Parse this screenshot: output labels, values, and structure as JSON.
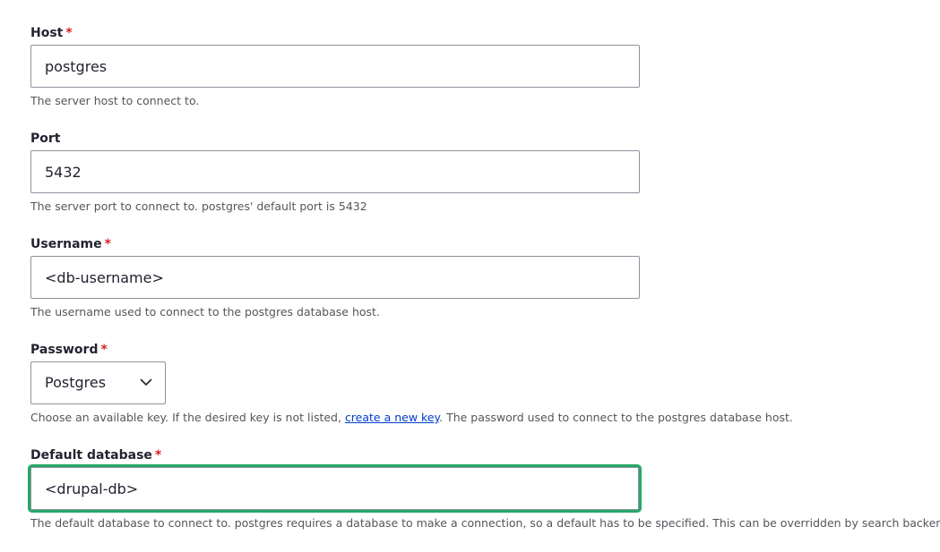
{
  "fields": {
    "host": {
      "label": "Host",
      "required_marker": "*",
      "value": "postgres",
      "description": "The server host to connect to."
    },
    "port": {
      "label": "Port",
      "value": "5432",
      "description": "The server port to connect to. postgres' default port is 5432"
    },
    "username": {
      "label": "Username",
      "required_marker": "*",
      "value": "<db-username>",
      "description": "The username used to connect to the postgres database host."
    },
    "password": {
      "label": "Password",
      "required_marker": "*",
      "selected_option": "Postgres",
      "description_prefix": "Choose an available key. If the desired key is not listed, ",
      "description_link": "create a new key",
      "description_suffix": ". The password used to connect to the postgres database host."
    },
    "default_database": {
      "label": "Default database",
      "required_marker": "*",
      "value": "<drupal-db>",
      "description": "The default database to connect to. postgres requires a database to make a connection, so a default has to be specified. This can be overridden by search backends that use this vc"
    }
  },
  "icons": {
    "select_arrow": "chevron-down-icon"
  },
  "colors": {
    "required": "#d72222",
    "focus_ring": "#26a769",
    "link": "#003ecc",
    "border": "#8e929c"
  }
}
